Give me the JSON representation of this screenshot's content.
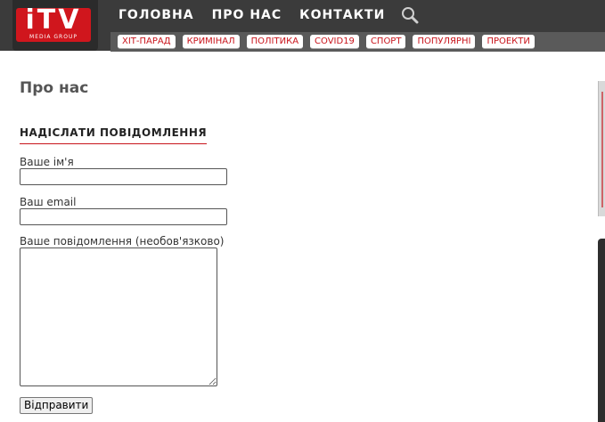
{
  "header": {
    "logo_text": "iTV",
    "logo_sub": "MEDIA GROUP",
    "nav": [
      "ГОЛОВНА",
      "ПРО НАС",
      "КОНТАКТИ"
    ],
    "categories": [
      "ХІТ-ПАРАД",
      "КРИМІНАЛ",
      "ПОЛІТИКА",
      "COVID19",
      "СПОРТ",
      "ПОПУЛЯРНІ",
      "ПРОЕКТИ"
    ],
    "accent_color": "#c8141b"
  },
  "page": {
    "title": "Про нас",
    "section_title": "НАДІСЛАТИ ПОВІДОМЛЕННЯ"
  },
  "form": {
    "name_label": "Ваше ім'я",
    "email_label": "Ваш email",
    "message_label": "Ваше повідомлення (необов'язково)",
    "submit_label": "Відправити"
  }
}
